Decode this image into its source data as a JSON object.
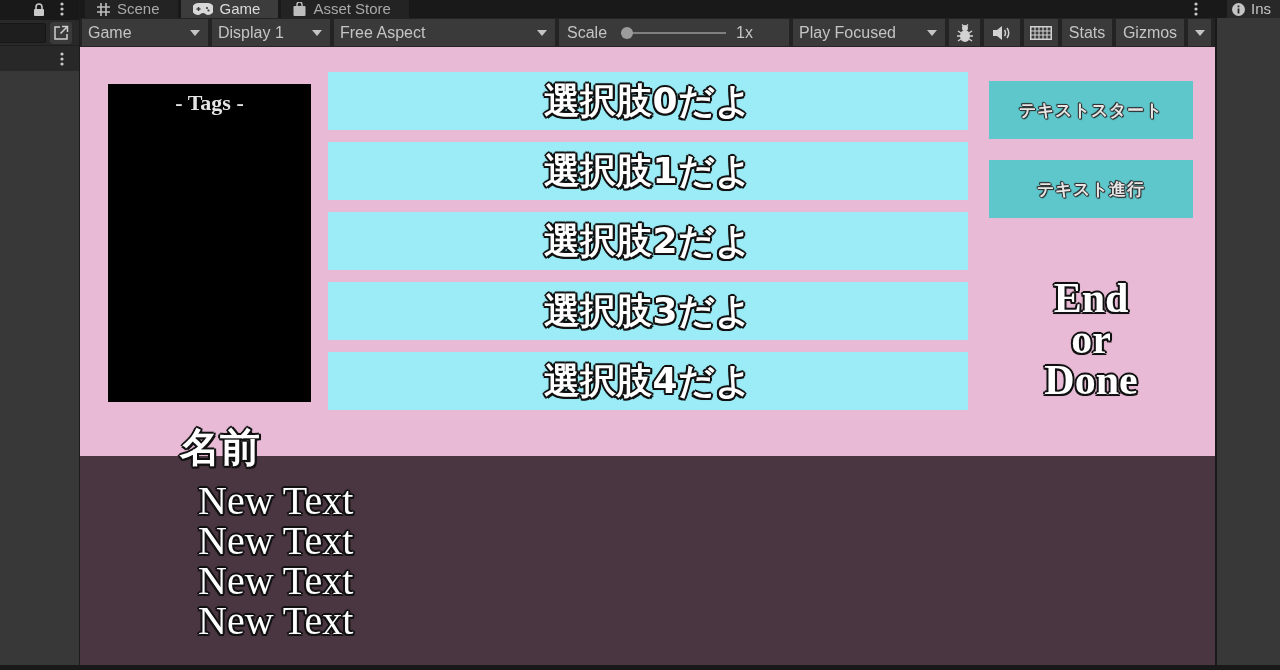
{
  "scene_tabs": [
    {
      "label": "Scene",
      "kind": "scene",
      "selected": false
    },
    {
      "label": "Game",
      "kind": "game",
      "selected": true
    },
    {
      "label": "Asset Store",
      "kind": "store",
      "selected": false
    }
  ],
  "inspector_tab": {
    "label": "Ins"
  },
  "toolbar": {
    "view_dropdown": "Game",
    "display_dropdown": "Display 1",
    "aspect_dropdown": "Free Aspect",
    "scale": {
      "label": "Scale",
      "level": 0,
      "reading": "1x"
    },
    "play_mode_dropdown": "Play Focused",
    "stats_button": "Stats",
    "gizmos_button": "Gizmos"
  },
  "game_view": {
    "tags_panel": {
      "title": "- Tags -"
    },
    "choices": [
      "選択肢0だよ",
      "選択肢1だよ",
      "選択肢2だよ",
      "選択肢3だよ",
      "選択肢4だよ"
    ],
    "buttons": [
      "テキストスタート",
      "テキスト進行"
    ],
    "end_label": "End or Done",
    "name_label": "名前",
    "message_lines": [
      "New Text",
      "New Text",
      "New Text",
      "New Text"
    ]
  }
}
